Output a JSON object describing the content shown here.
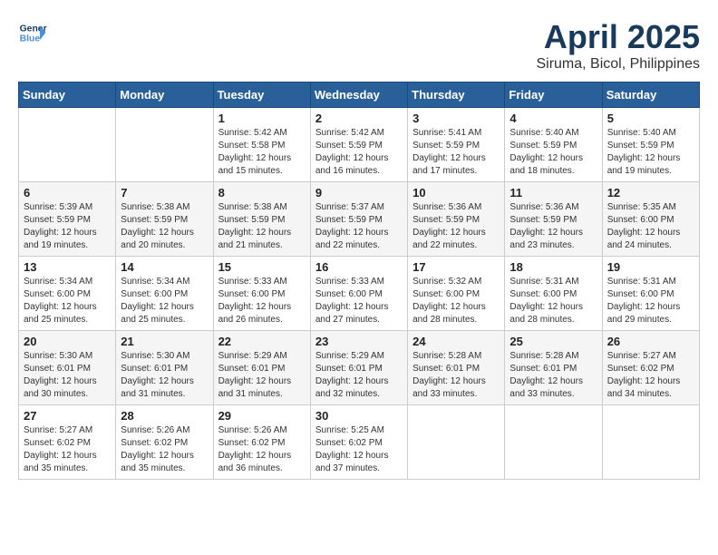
{
  "logo": {
    "text_general": "General",
    "text_blue": "Blue"
  },
  "title": "April 2025",
  "subtitle": "Siruma, Bicol, Philippines",
  "days_of_week": [
    "Sunday",
    "Monday",
    "Tuesday",
    "Wednesday",
    "Thursday",
    "Friday",
    "Saturday"
  ],
  "weeks": [
    [
      {
        "day": "",
        "sunrise": "",
        "sunset": "",
        "daylight": ""
      },
      {
        "day": "",
        "sunrise": "",
        "sunset": "",
        "daylight": ""
      },
      {
        "day": "1",
        "sunrise": "Sunrise: 5:42 AM",
        "sunset": "Sunset: 5:58 PM",
        "daylight": "Daylight: 12 hours and 15 minutes."
      },
      {
        "day": "2",
        "sunrise": "Sunrise: 5:42 AM",
        "sunset": "Sunset: 5:59 PM",
        "daylight": "Daylight: 12 hours and 16 minutes."
      },
      {
        "day": "3",
        "sunrise": "Sunrise: 5:41 AM",
        "sunset": "Sunset: 5:59 PM",
        "daylight": "Daylight: 12 hours and 17 minutes."
      },
      {
        "day": "4",
        "sunrise": "Sunrise: 5:40 AM",
        "sunset": "Sunset: 5:59 PM",
        "daylight": "Daylight: 12 hours and 18 minutes."
      },
      {
        "day": "5",
        "sunrise": "Sunrise: 5:40 AM",
        "sunset": "Sunset: 5:59 PM",
        "daylight": "Daylight: 12 hours and 19 minutes."
      }
    ],
    [
      {
        "day": "6",
        "sunrise": "Sunrise: 5:39 AM",
        "sunset": "Sunset: 5:59 PM",
        "daylight": "Daylight: 12 hours and 19 minutes."
      },
      {
        "day": "7",
        "sunrise": "Sunrise: 5:38 AM",
        "sunset": "Sunset: 5:59 PM",
        "daylight": "Daylight: 12 hours and 20 minutes."
      },
      {
        "day": "8",
        "sunrise": "Sunrise: 5:38 AM",
        "sunset": "Sunset: 5:59 PM",
        "daylight": "Daylight: 12 hours and 21 minutes."
      },
      {
        "day": "9",
        "sunrise": "Sunrise: 5:37 AM",
        "sunset": "Sunset: 5:59 PM",
        "daylight": "Daylight: 12 hours and 22 minutes."
      },
      {
        "day": "10",
        "sunrise": "Sunrise: 5:36 AM",
        "sunset": "Sunset: 5:59 PM",
        "daylight": "Daylight: 12 hours and 22 minutes."
      },
      {
        "day": "11",
        "sunrise": "Sunrise: 5:36 AM",
        "sunset": "Sunset: 5:59 PM",
        "daylight": "Daylight: 12 hours and 23 minutes."
      },
      {
        "day": "12",
        "sunrise": "Sunrise: 5:35 AM",
        "sunset": "Sunset: 6:00 PM",
        "daylight": "Daylight: 12 hours and 24 minutes."
      }
    ],
    [
      {
        "day": "13",
        "sunrise": "Sunrise: 5:34 AM",
        "sunset": "Sunset: 6:00 PM",
        "daylight": "Daylight: 12 hours and 25 minutes."
      },
      {
        "day": "14",
        "sunrise": "Sunrise: 5:34 AM",
        "sunset": "Sunset: 6:00 PM",
        "daylight": "Daylight: 12 hours and 25 minutes."
      },
      {
        "day": "15",
        "sunrise": "Sunrise: 5:33 AM",
        "sunset": "Sunset: 6:00 PM",
        "daylight": "Daylight: 12 hours and 26 minutes."
      },
      {
        "day": "16",
        "sunrise": "Sunrise: 5:33 AM",
        "sunset": "Sunset: 6:00 PM",
        "daylight": "Daylight: 12 hours and 27 minutes."
      },
      {
        "day": "17",
        "sunrise": "Sunrise: 5:32 AM",
        "sunset": "Sunset: 6:00 PM",
        "daylight": "Daylight: 12 hours and 28 minutes."
      },
      {
        "day": "18",
        "sunrise": "Sunrise: 5:31 AM",
        "sunset": "Sunset: 6:00 PM",
        "daylight": "Daylight: 12 hours and 28 minutes."
      },
      {
        "day": "19",
        "sunrise": "Sunrise: 5:31 AM",
        "sunset": "Sunset: 6:00 PM",
        "daylight": "Daylight: 12 hours and 29 minutes."
      }
    ],
    [
      {
        "day": "20",
        "sunrise": "Sunrise: 5:30 AM",
        "sunset": "Sunset: 6:01 PM",
        "daylight": "Daylight: 12 hours and 30 minutes."
      },
      {
        "day": "21",
        "sunrise": "Sunrise: 5:30 AM",
        "sunset": "Sunset: 6:01 PM",
        "daylight": "Daylight: 12 hours and 31 minutes."
      },
      {
        "day": "22",
        "sunrise": "Sunrise: 5:29 AM",
        "sunset": "Sunset: 6:01 PM",
        "daylight": "Daylight: 12 hours and 31 minutes."
      },
      {
        "day": "23",
        "sunrise": "Sunrise: 5:29 AM",
        "sunset": "Sunset: 6:01 PM",
        "daylight": "Daylight: 12 hours and 32 minutes."
      },
      {
        "day": "24",
        "sunrise": "Sunrise: 5:28 AM",
        "sunset": "Sunset: 6:01 PM",
        "daylight": "Daylight: 12 hours and 33 minutes."
      },
      {
        "day": "25",
        "sunrise": "Sunrise: 5:28 AM",
        "sunset": "Sunset: 6:01 PM",
        "daylight": "Daylight: 12 hours and 33 minutes."
      },
      {
        "day": "26",
        "sunrise": "Sunrise: 5:27 AM",
        "sunset": "Sunset: 6:02 PM",
        "daylight": "Daylight: 12 hours and 34 minutes."
      }
    ],
    [
      {
        "day": "27",
        "sunrise": "Sunrise: 5:27 AM",
        "sunset": "Sunset: 6:02 PM",
        "daylight": "Daylight: 12 hours and 35 minutes."
      },
      {
        "day": "28",
        "sunrise": "Sunrise: 5:26 AM",
        "sunset": "Sunset: 6:02 PM",
        "daylight": "Daylight: 12 hours and 35 minutes."
      },
      {
        "day": "29",
        "sunrise": "Sunrise: 5:26 AM",
        "sunset": "Sunset: 6:02 PM",
        "daylight": "Daylight: 12 hours and 36 minutes."
      },
      {
        "day": "30",
        "sunrise": "Sunrise: 5:25 AM",
        "sunset": "Sunset: 6:02 PM",
        "daylight": "Daylight: 12 hours and 37 minutes."
      },
      {
        "day": "",
        "sunrise": "",
        "sunset": "",
        "daylight": ""
      },
      {
        "day": "",
        "sunrise": "",
        "sunset": "",
        "daylight": ""
      },
      {
        "day": "",
        "sunrise": "",
        "sunset": "",
        "daylight": ""
      }
    ]
  ]
}
